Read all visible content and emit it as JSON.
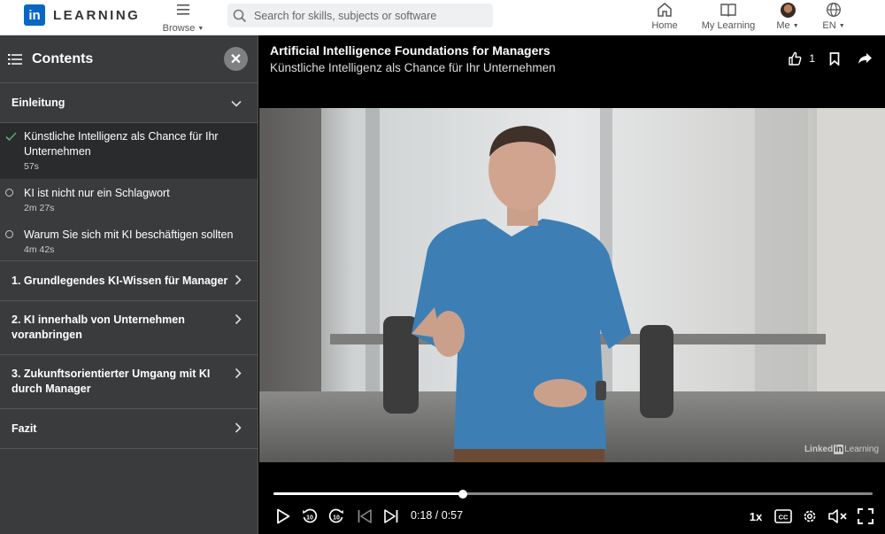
{
  "nav": {
    "logo_mark": "in",
    "logo_text": "LEARNING",
    "browse_label": "Browse",
    "search_placeholder": "Search for skills, subjects or software",
    "home_label": "Home",
    "mylearning_label": "My Learning",
    "me_label": "Me",
    "lang_label": "EN"
  },
  "sidebar": {
    "title": "Contents",
    "sections": [
      {
        "label": "Einleitung",
        "expanded": true,
        "lessons": [
          {
            "title": "Künstliche Intelligenz als Chance für Ihr Unternehmen",
            "duration": "57s",
            "state": "completed"
          },
          {
            "title": "KI ist nicht nur ein Schlagwort",
            "duration": "2m 27s",
            "state": "unwatched"
          },
          {
            "title": "Warum Sie sich mit KI beschäftigen sollten",
            "duration": "4m 42s",
            "state": "unwatched"
          }
        ]
      },
      {
        "label": "1. Grundlegendes KI-Wissen für Manager",
        "expanded": false
      },
      {
        "label": "2. KI innerhalb von Unternehmen voranbringen",
        "expanded": false
      },
      {
        "label": "3. Zukunftsorientierter Umgang mit KI durch Manager",
        "expanded": false
      },
      {
        "label": "Fazit",
        "expanded": false
      }
    ]
  },
  "player": {
    "course_title": "Artificial Intelligence Foundations for Managers",
    "video_title": "Künstliche Intelligenz als Chance für Ihr Unternehmen",
    "like_count": "1",
    "current_time": "0:18",
    "total_time": "0:57",
    "time_display": "0:18 / 0:57",
    "progress": 0.316,
    "speed": "1x",
    "cc_label": "CC",
    "watermark": {
      "brand": "Linked",
      "in": "in",
      "product": "Learning"
    }
  },
  "colors": {
    "accent": "#0a66c2",
    "sidebar_bg": "#3a3b3c",
    "completed_check": "#57a773"
  }
}
